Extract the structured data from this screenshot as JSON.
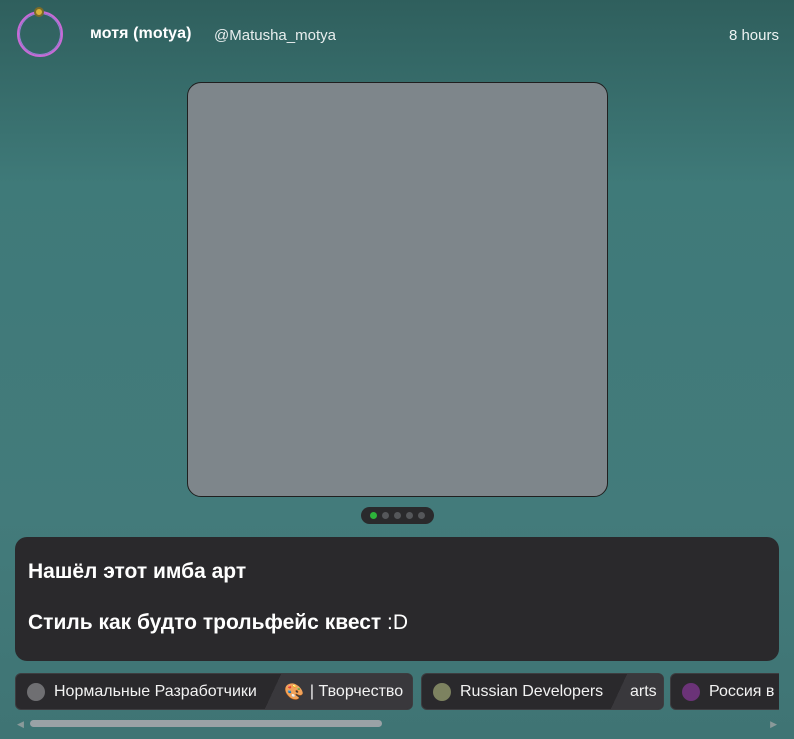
{
  "post": {
    "author_name": "мотя (motya)",
    "handle": "@Matusha_motya",
    "time": "8 hours"
  },
  "carousel": {
    "slide_count": 5,
    "active_index": 0,
    "active_color": "#2db33a"
  },
  "message": {
    "line1": "Нашёл этот имба арт",
    "line2_bold": "Стиль как будто трольфейс квест",
    "line2_plain": " :D"
  },
  "tags": [
    {
      "left_circle_color": "#6f6f72",
      "left_label": "Нормальные Разработчики",
      "right_icon": "palette-icon",
      "right_glyph": "🎨",
      "right_label": "| Творчество"
    },
    {
      "left_circle_color": "#7d8260",
      "left_label": "Russian Developers",
      "right_label": "arts"
    },
    {
      "left_circle_color": "#6b3378",
      "left_label": "Россия в"
    }
  ],
  "colors": {
    "card_bg": "#2a292c",
    "media_placeholder": "#7e868b"
  }
}
